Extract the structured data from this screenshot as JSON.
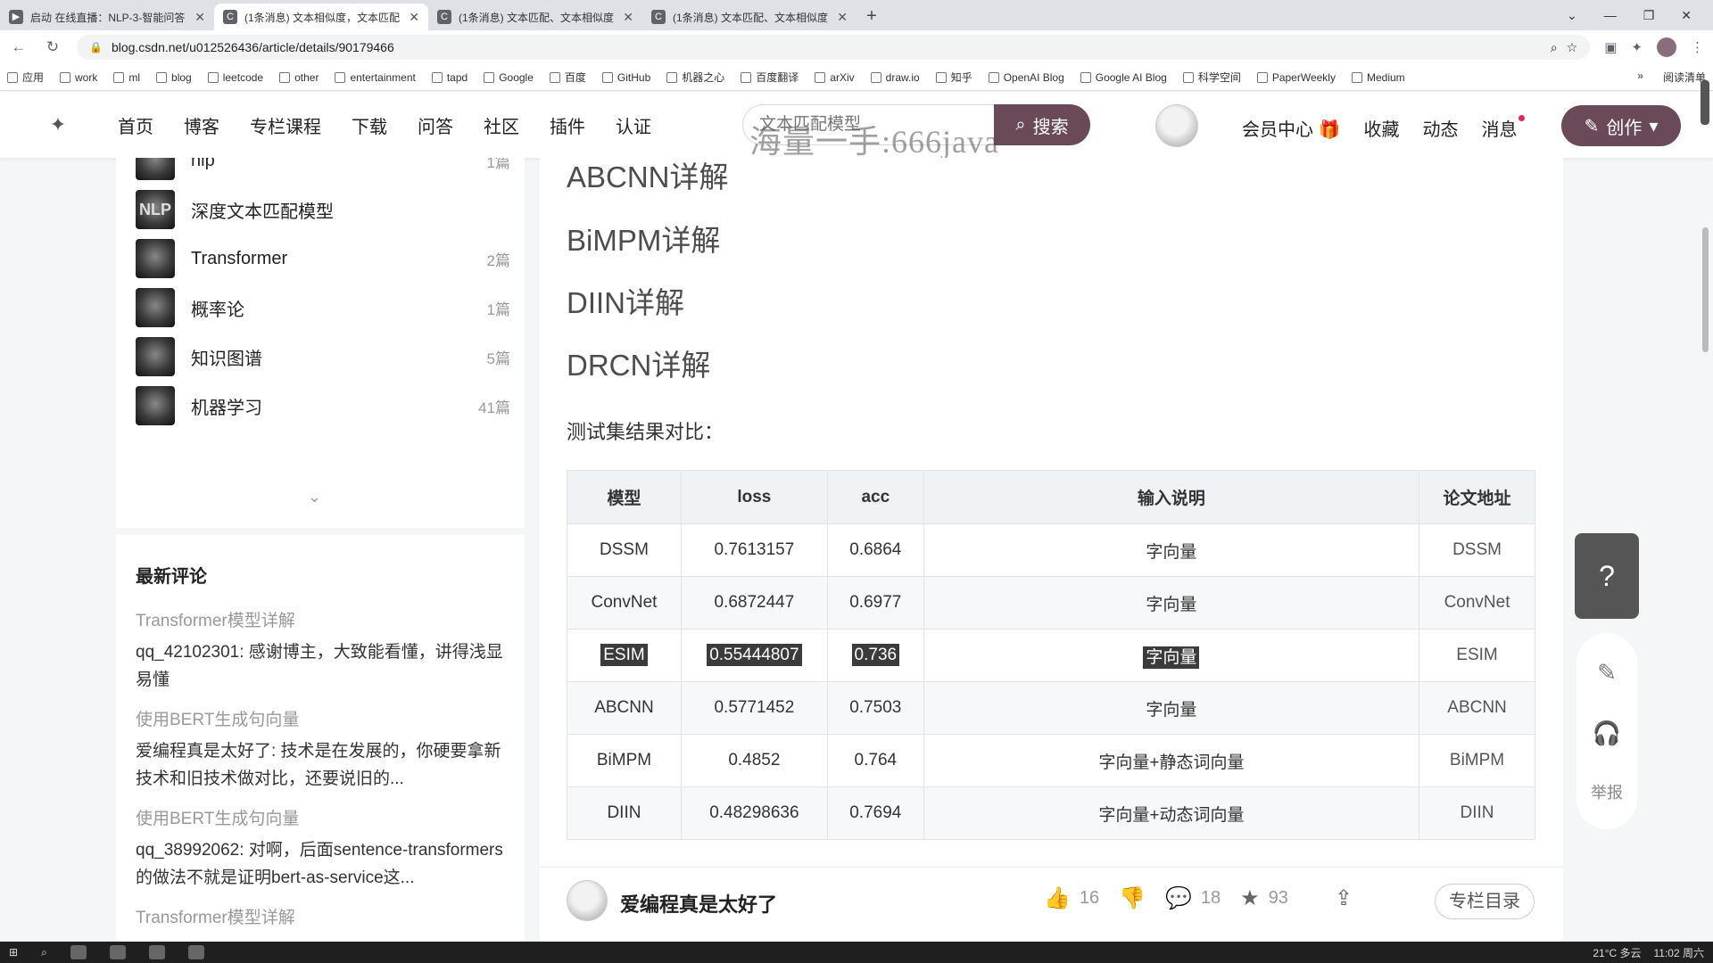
{
  "browser": {
    "tabs": [
      {
        "favicon": "▶",
        "label": "启动 在线直播：NLP-3-智能问答",
        "active": false
      },
      {
        "favicon": "C",
        "label": "(1条消息) 文本相似度，文本匹配",
        "active": true
      },
      {
        "favicon": "C",
        "label": "(1条消息) 文本匹配、文本相似度",
        "active": false
      },
      {
        "favicon": "C",
        "label": "(1条消息) 文本匹配、文本相似度",
        "active": false
      }
    ],
    "new_tab": "+",
    "close_glyph": "✕",
    "url": "blog.csdn.net/u012526436/article/details/90179466",
    "bookmarks": [
      "应用",
      "work",
      "ml",
      "blog",
      "leetcode",
      "other",
      "entertainment",
      "tapd",
      "Google",
      "百度",
      "GitHub",
      "机器之心",
      "百度翻译",
      "arXiv",
      "draw.io",
      "知乎",
      "OpenAI Blog",
      "Google AI Blog",
      "科学空间",
      "PaperWeekly",
      "Medium"
    ],
    "bookmarks_more": "»",
    "reading_list": "阅读清单"
  },
  "header": {
    "nav": [
      "首页",
      "博客",
      "专栏课程",
      "下载",
      "问答",
      "社区",
      "插件",
      "认证"
    ],
    "active_nav": "博客",
    "search_placeholder": "文本匹配模型",
    "search_button": "搜索",
    "watermark": "海量一手:666java",
    "right_nav": [
      "会员中心",
      "收藏",
      "动态",
      "消息"
    ],
    "create_button": "创作"
  },
  "sidebar": {
    "columns": [
      {
        "name": "nlp",
        "count": "1篇",
        "thumb": ""
      },
      {
        "name": "深度文本匹配模型",
        "count": "",
        "thumb": "NLP"
      },
      {
        "name": "Transformer",
        "count": "2篇",
        "thumb": ""
      },
      {
        "name": "概率论",
        "count": "1篇",
        "thumb": ""
      },
      {
        "name": "知识图谱",
        "count": "5篇",
        "thumb": ""
      },
      {
        "name": "机器学习",
        "count": "41篇",
        "thumb": ""
      }
    ],
    "comments_title": "最新评论",
    "comments": [
      {
        "title": "Transformer模型详解",
        "text": "qq_42102301: 感谢博主，大致能看懂，讲得浅显易懂"
      },
      {
        "title": "使用BERT生成句向量",
        "text": "爱编程真是太好了: 技术是在发展的，你硬要拿新技术和旧技术做对比，还要说旧的..."
      },
      {
        "title": "使用BERT生成句向量",
        "text": "qq_38992062: 对啊，后面sentence-transformers的做法不就是证明bert-as-service这..."
      },
      {
        "title": "Transformer模型详解",
        "text": ""
      }
    ]
  },
  "article": {
    "headings": [
      "ABCNN详解",
      "BiMPM详解",
      "DIIN详解",
      "DRCN详解"
    ],
    "paragraph": "测试集结果对比：",
    "table": {
      "headers": [
        "模型",
        "loss",
        "acc",
        "输入说明",
        "论文地址"
      ],
      "rows": [
        {
          "model": "DSSM",
          "loss": "0.7613157",
          "acc": "0.6864",
          "input": "字向量",
          "paper": "DSSM",
          "highlight": false
        },
        {
          "model": "ConvNet",
          "loss": "0.6872447",
          "acc": "0.6977",
          "input": "字向量",
          "paper": "ConvNet",
          "highlight": false
        },
        {
          "model": "ESIM",
          "loss": "0.55444807",
          "acc": "0.736",
          "input": "字向量",
          "paper": "ESIM",
          "highlight": true
        },
        {
          "model": "ABCNN",
          "loss": "0.5771452",
          "acc": "0.7503",
          "input": "字向量",
          "paper": "ABCNN",
          "highlight": false
        },
        {
          "model": "BiMPM",
          "loss": "0.4852",
          "acc": "0.764",
          "input": "字向量+静态词向量",
          "paper": "BiMPM",
          "highlight": false
        },
        {
          "model": "DIIN",
          "loss": "0.48298636",
          "acc": "0.7694",
          "input": "字向量+动态词向量",
          "paper": "DIIN",
          "highlight": false
        }
      ]
    }
  },
  "bottom_bar": {
    "author": "爱编程真是太好了",
    "likes": "16",
    "comments": "18",
    "favorites": "93",
    "toc_button": "专栏目录"
  },
  "float_tools": {
    "report": "举报"
  },
  "taskbar": {
    "weather": "21°C 多云",
    "time": "11:02 周六"
  }
}
